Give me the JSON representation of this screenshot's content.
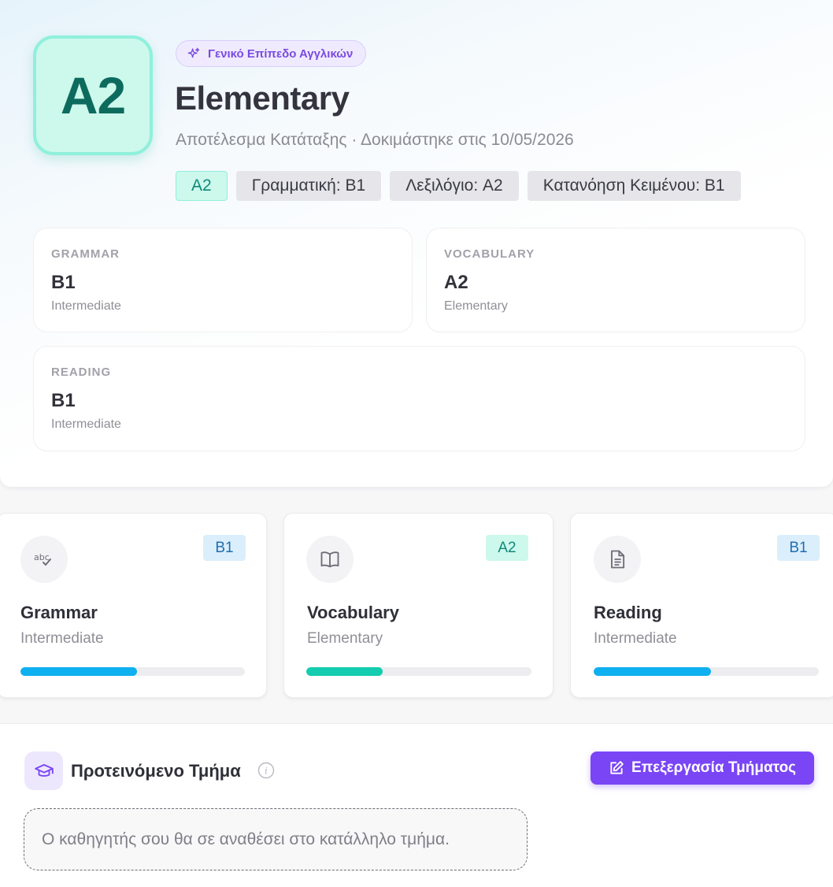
{
  "hero": {
    "level_code": "A2",
    "tag_label": "Γενικό Επίπεδο Αγγλικών",
    "title": "Elementary",
    "subtitle": "Αποτέλεσμα Κατάταξης · Δοκιμάστηκε στις 10/05/2026",
    "chips": [
      "A2",
      "Γραμματική: B1",
      "Λεξιλόγιο: A2",
      "Κατανόηση Κειμένου: B1"
    ]
  },
  "skill_cards": [
    {
      "label": "GRAMMAR",
      "level": "B1",
      "description": "Intermediate"
    },
    {
      "label": "VOCABULARY",
      "level": "A2",
      "description": "Elementary"
    },
    {
      "label": "READING",
      "level": "B1",
      "description": "Intermediate"
    }
  ],
  "progress_cards": [
    {
      "title": "Grammar",
      "description": "Intermediate",
      "badge": "B1",
      "badge_color": "#dbeefb",
      "icon": "spellcheck-icon",
      "progress": 0.52,
      "bar_color": "#0fb0ef"
    },
    {
      "title": "Vocabulary",
      "description": "Elementary",
      "badge": "A2",
      "badge_color": "#cdf8ec",
      "icon": "book-icon",
      "progress": 0.34,
      "bar_color": "#14cdb0"
    },
    {
      "title": "Reading",
      "description": "Intermediate",
      "badge": "B1",
      "badge_color": "#dbeefb",
      "icon": "document-icon",
      "progress": 0.52,
      "bar_color": "#0fb0ef"
    }
  ],
  "recommended_class": {
    "title": "Προτεινόμενο Τμήμα",
    "edit_button_label": "Επεξεργασία Τμήματος",
    "note": "Ο καθηγητής σου θα σε αναθέσει στο κατάλληλο τμήμα."
  },
  "colors": {
    "accent": "#7a45f5",
    "level_teal": "#0d6b5e",
    "progress_blue": "#0fb0ef",
    "progress_teal": "#14cdb0"
  }
}
